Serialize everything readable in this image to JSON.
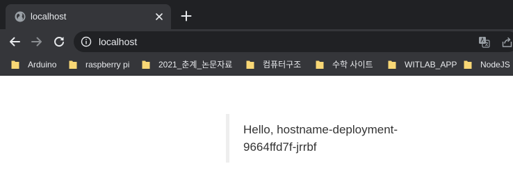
{
  "tab": {
    "title": "localhost",
    "favicon": "globe-icon",
    "close_icon": "close-icon"
  },
  "new_tab_icon": "plus-icon",
  "toolbar": {
    "back_icon": "arrow-left-icon",
    "forward_icon": "arrow-right-icon",
    "reload_icon": "reload-icon",
    "site_info_icon": "info-icon",
    "url": "localhost",
    "translate_icon": "translate-icon",
    "share_icon": "share-icon"
  },
  "bookmarks": [
    {
      "label": "Arduino",
      "icon": "folder-icon"
    },
    {
      "label": "raspberry pi",
      "icon": "folder-icon"
    },
    {
      "label": "2021_춘계_논문자료",
      "icon": "folder-icon"
    },
    {
      "label": "컴퓨터구조",
      "icon": "folder-icon"
    },
    {
      "label": "수학 사이트",
      "icon": "folder-icon"
    },
    {
      "label": "WITLAB_APP",
      "icon": "folder-icon"
    },
    {
      "label": "NodeJS",
      "icon": "folder-icon"
    }
  ],
  "page": {
    "message": "Hello, hostname-deployment-9664ffd7f-jrrbf"
  },
  "colors": {
    "tabstrip_bg": "#202124",
    "toolbar_bg": "#35363a",
    "omnibox_bg": "#202124",
    "browser_text": "#e8eaed",
    "folder_yellow": "#f8d775",
    "quote_border": "#eeeeee",
    "page_text": "#333333"
  }
}
